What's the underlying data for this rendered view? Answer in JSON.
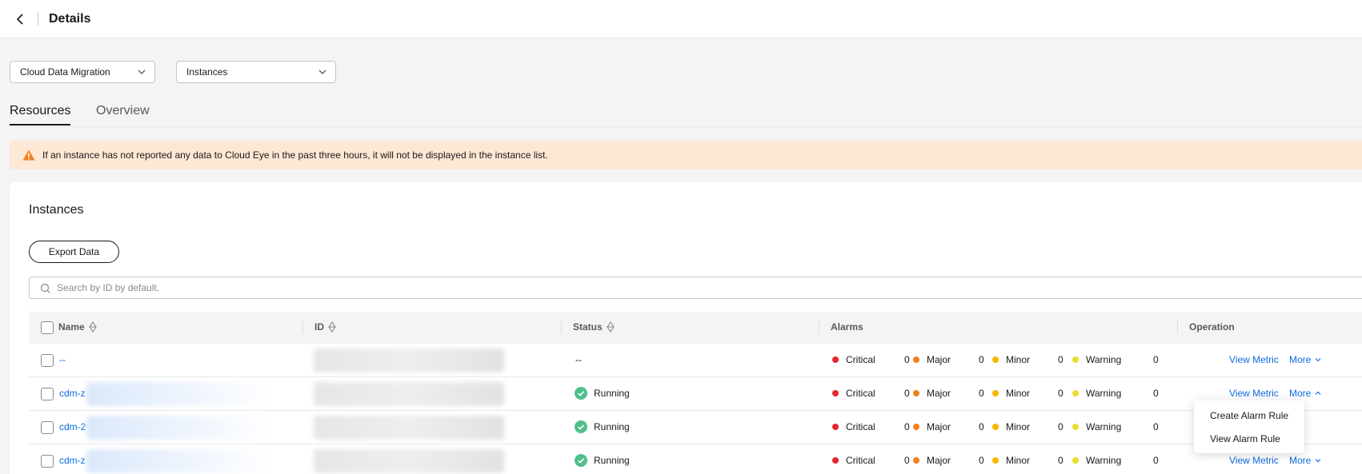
{
  "header": {
    "title": "Details"
  },
  "filters": {
    "service": "Cloud Data Migration",
    "dimension": "Instances"
  },
  "tabs": [
    {
      "label": "Resources",
      "active": true
    },
    {
      "label": "Overview",
      "active": false
    }
  ],
  "notice": {
    "text": "If an instance has not reported any data to Cloud Eye in the past three hours, it will not be displayed in the instance list."
  },
  "instances": {
    "title": "Instances",
    "export_label": "Export Data",
    "search_placeholder": "Search by ID by default.",
    "columns": [
      "Name",
      "ID",
      "Status",
      "Alarms",
      "Operation"
    ],
    "alarm_labels": [
      "Critical",
      "Major",
      "Minor",
      "Warning"
    ],
    "alarm_colors": [
      "#e5252f",
      "#f3801e",
      "#f5b800",
      "#e9de2c"
    ],
    "rows": [
      {
        "name": "--",
        "status": "--",
        "alarms": [
          "0",
          "0",
          "0",
          "0"
        ],
        "view_metric": "View Metric",
        "more": "More"
      },
      {
        "name": "cdm-z",
        "status": "Running",
        "alarms": [
          "0",
          "0",
          "0",
          "0"
        ],
        "view_metric": "View Metric",
        "more": "More"
      },
      {
        "name": "cdm-2",
        "status": "Running",
        "alarms": [
          "0",
          "0",
          "0",
          "0"
        ],
        "view_metric": "View Metric",
        "more": "More"
      },
      {
        "name": "cdm-z",
        "status": "Running",
        "alarms": [
          "0",
          "0",
          "0",
          "0"
        ],
        "view_metric": "View Metric",
        "more": "More"
      }
    ]
  },
  "more_menu": {
    "items": [
      "Create Alarm Rule",
      "View Alarm Rule"
    ]
  }
}
